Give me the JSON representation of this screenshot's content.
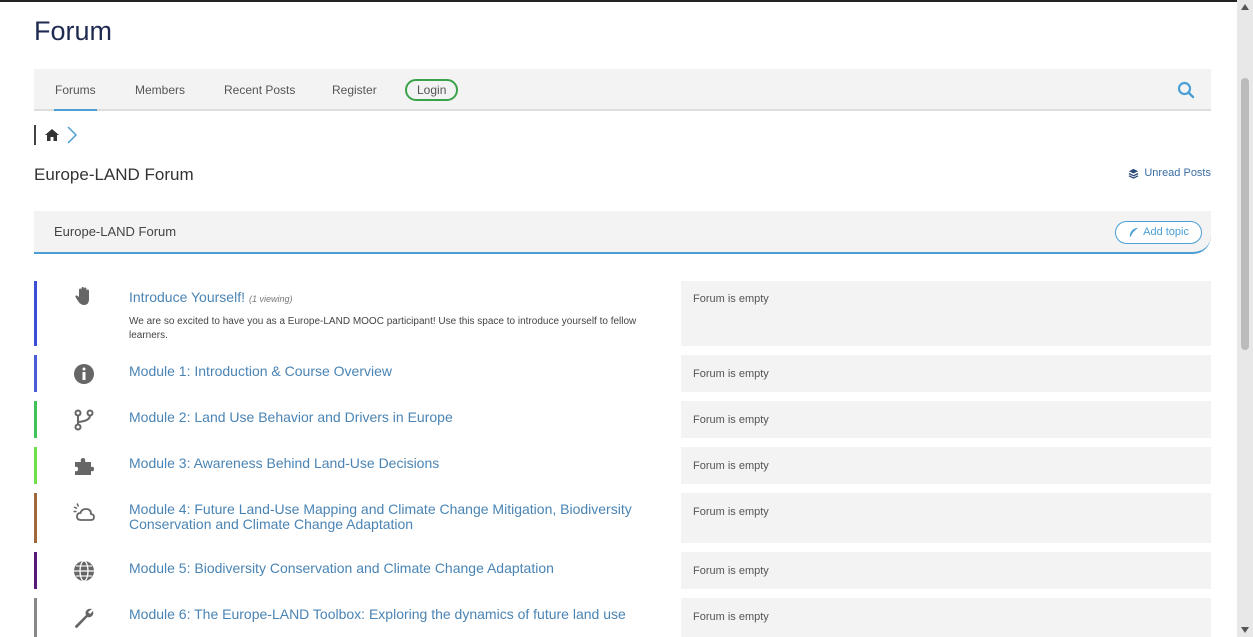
{
  "site": {
    "title": "Forum"
  },
  "nav": {
    "items": [
      {
        "label": "Forums"
      },
      {
        "label": "Members"
      },
      {
        "label": "Recent Posts"
      },
      {
        "label": "Register"
      },
      {
        "label": "Login"
      }
    ],
    "search_icon": "search-icon"
  },
  "breadcrumb": {
    "home_icon": "home-icon",
    "separator_icon": "chevron-right-icon"
  },
  "page": {
    "title": "Europe-LAND Forum",
    "unread_label": "Unread Posts"
  },
  "category": {
    "title": "Europe-LAND Forum",
    "add_topic_label": "Add topic"
  },
  "forums": [
    {
      "title": "Introduce Yourself!",
      "viewing": "(1 viewing)",
      "description": "We are so excited to have you as a Europe-LAND MOOC participant! Use this space to introduce yourself to fellow learners.",
      "last_post": "Forum is empty",
      "color": "#3b4fd6",
      "icon": "hand-icon"
    },
    {
      "title": "Module 1: Introduction & Course Overview",
      "last_post": "Forum is empty",
      "color": "#4b5ed8",
      "icon": "info-icon"
    },
    {
      "title": "Module 2: Land Use Behavior and Drivers in Europe",
      "last_post": "Forum is empty",
      "color": "#3ec25a",
      "icon": "branch-icon"
    },
    {
      "title": "Module 3: Awareness Behind Land-Use Decisions",
      "last_post": "Forum is empty",
      "color": "#6fe04a",
      "icon": "puzzle-icon"
    },
    {
      "title": "Module 4: Future Land-Use Mapping and Climate Change Mitigation, Biodiversity Conservation and Climate Change Adaptation",
      "last_post": "Forum is empty",
      "color": "#a0683a",
      "icon": "cloud-sun-icon"
    },
    {
      "title": "Module 5: Biodiversity Conservation and Climate Change Adaptation",
      "last_post": "Forum is empty",
      "color": "#5a1a7a",
      "icon": "globe-icon"
    },
    {
      "title": "Module 6: The Europe-LAND Toolbox: Exploring the dynamics of future land use",
      "last_post": "Forum is empty",
      "color": "#888888",
      "icon": "wrench-icon"
    }
  ]
}
